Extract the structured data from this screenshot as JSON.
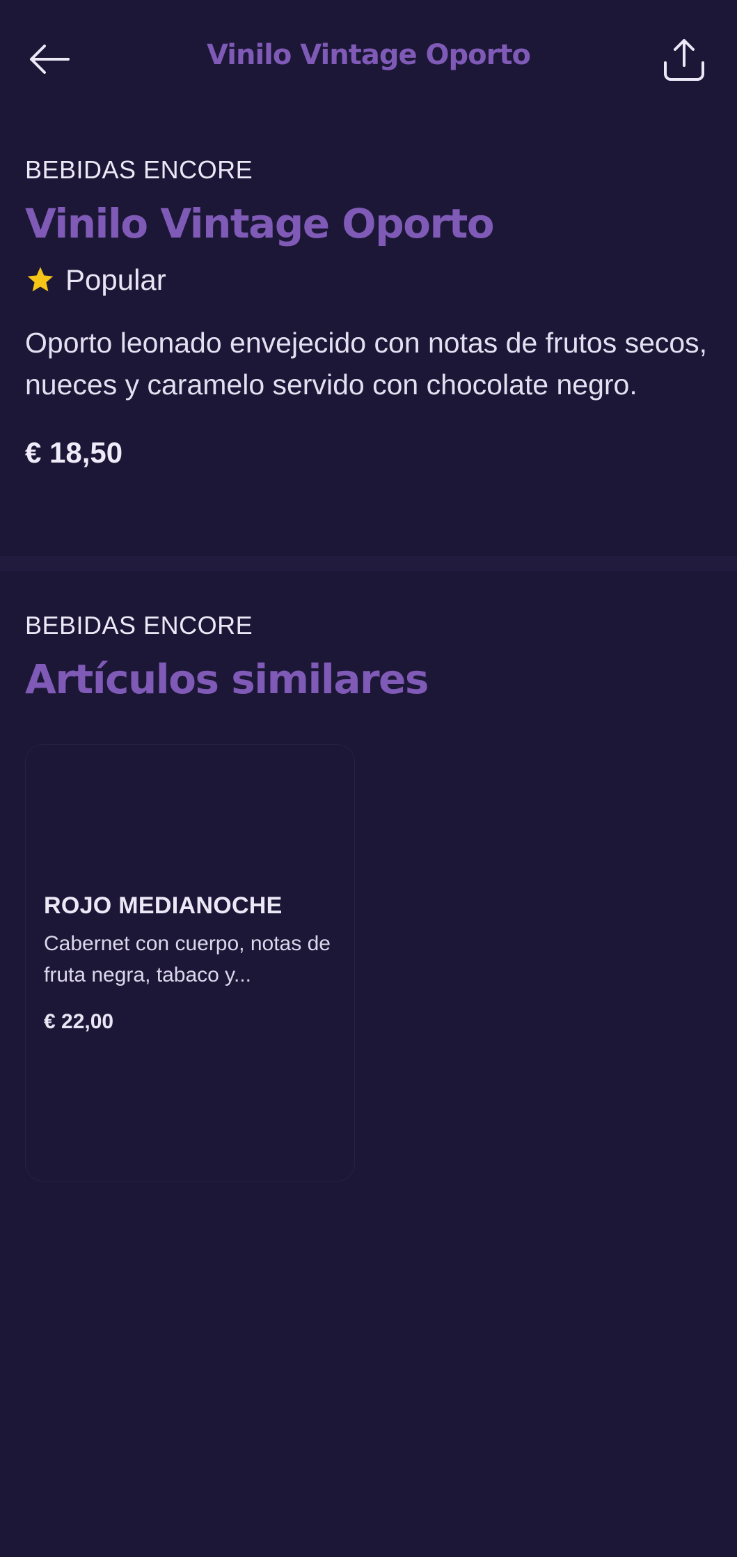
{
  "header": {
    "title": "Vinilo Vintage Oporto",
    "back_icon": "arrow-left-icon",
    "share_icon": "share-icon"
  },
  "product": {
    "brand": "BEBIDAS ENCORE",
    "name": "Vinilo Vintage Oporto",
    "badge_icon": "star-icon",
    "badge_label": "Popular",
    "description": "Oporto leonado envejecido con notas de frutos secos, nueces y caramelo servido con chocolate negro.",
    "price": "€ 18,50"
  },
  "similar": {
    "brand": "BEBIDAS ENCORE",
    "title": "Artículos similares",
    "items": [
      {
        "name": "ROJO MEDIANOCHE",
        "description": "Cabernet con cuerpo, notas de fruta negra, tabaco y...",
        "price": "€ 22,00"
      }
    ]
  },
  "colors": {
    "background": "#1c1736",
    "accent": "#7f5ab6",
    "star": "#f5c518",
    "text": "#e9e5f5"
  }
}
